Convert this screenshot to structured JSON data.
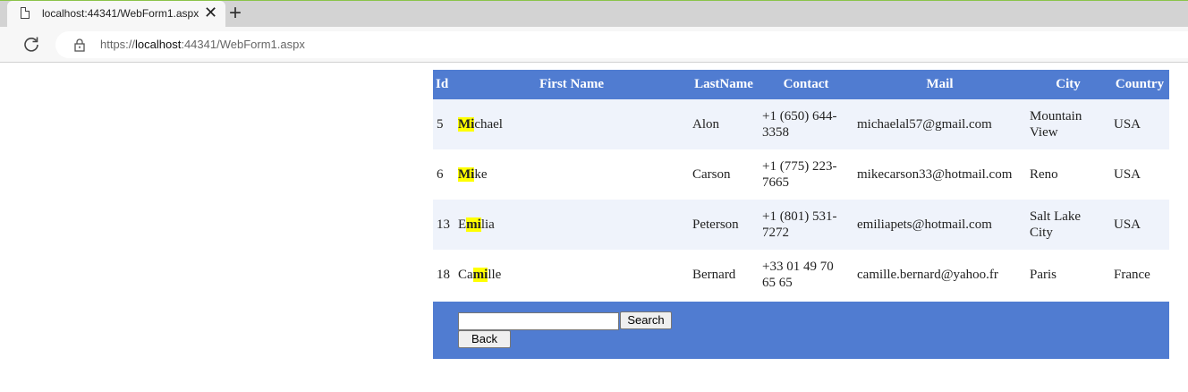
{
  "browser": {
    "tab_title": "localhost:44341/WebForm1.aspx",
    "close_symbol": "✕",
    "new_tab_symbol": "+",
    "url_scheme": "https://",
    "url_host": "localhost",
    "url_rest": ":44341/WebForm1.aspx"
  },
  "table": {
    "headers": [
      "Id",
      "First Name",
      "LastName",
      "Contact",
      "Mail",
      "City",
      "Country"
    ],
    "search_term": "mi",
    "rows": [
      {
        "id": "5",
        "first_pre": "",
        "first_hl": "Mi",
        "first_post": "chael",
        "last": "Alon",
        "contact": "+1 (650) 644-3358",
        "mail": "michaelal57@gmail.com",
        "city": "Mountain View",
        "country": "USA"
      },
      {
        "id": "6",
        "first_pre": "",
        "first_hl": "Mi",
        "first_post": "ke",
        "last": "Carson",
        "contact": "+1 (775) 223-7665",
        "mail": "mikecarson33@hotmail.com",
        "city": "Reno",
        "country": "USA"
      },
      {
        "id": "13",
        "first_pre": "E",
        "first_hl": "mi",
        "first_post": "lia",
        "last": "Peterson",
        "contact": "+1 (801) 531-7272",
        "mail": "emiliapets@hotmail.com",
        "city": "Salt Lake City",
        "country": "USA"
      },
      {
        "id": "18",
        "first_pre": "Ca",
        "first_hl": "mi",
        "first_post": "lle",
        "last": "Bernard",
        "contact": "+33 01 49 70 65 65",
        "mail": "camille.bernard@yahoo.fr",
        "city": "Paris",
        "country": "France"
      }
    ]
  },
  "form": {
    "search_value": "",
    "search_button": "Search",
    "back_button": "Back"
  },
  "colors": {
    "header_bg": "#507cd1",
    "alt_row_bg": "#eff3fb",
    "highlight": "#ffff00"
  }
}
